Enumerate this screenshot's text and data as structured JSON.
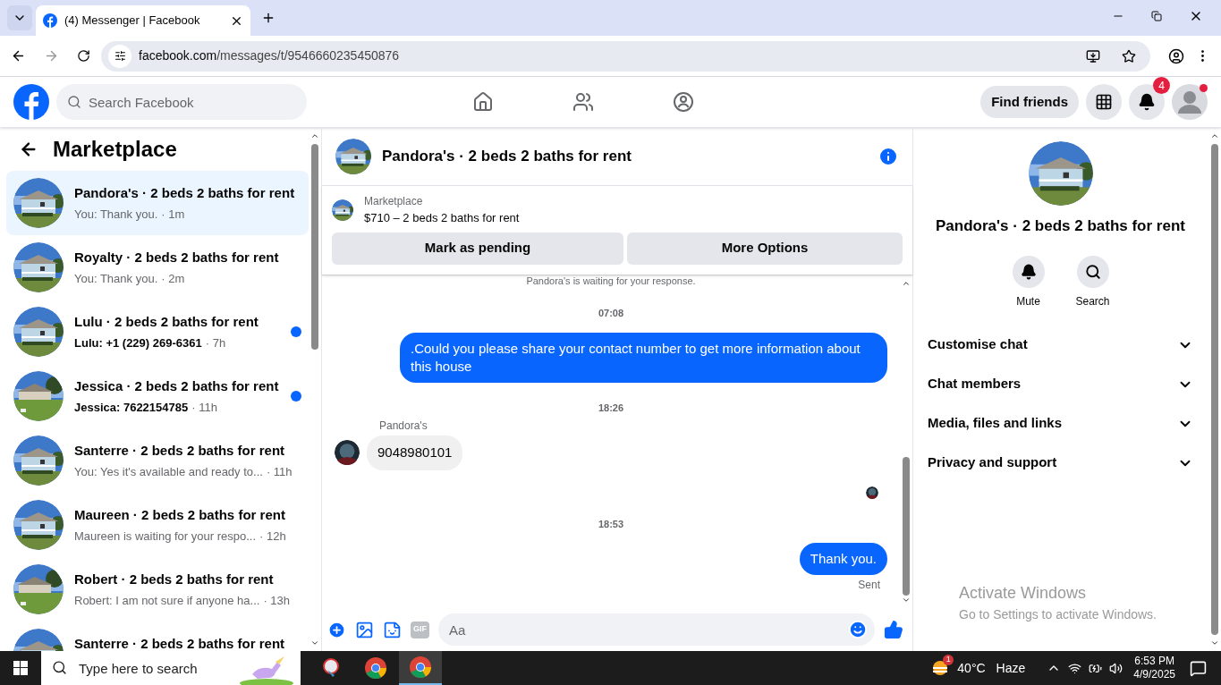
{
  "browser": {
    "tab_title": "(4) Messenger | Facebook",
    "url_host": "facebook.com",
    "url_path": "/messages/t/9546660235450876"
  },
  "header": {
    "search_placeholder": "Search Facebook",
    "find_friends": "Find friends",
    "notification_count": "4"
  },
  "sidebar": {
    "title": "Marketplace",
    "threads": [
      {
        "name": "Pandora's · 2 beds 2 baths for rent",
        "preview": "You: Thank you.",
        "time": "· 1m",
        "unread": false,
        "selected": true
      },
      {
        "name": "Royalty · 2 beds 2 baths for rent",
        "preview": "You: Thank you.",
        "time": "· 2m",
        "unread": false,
        "selected": false
      },
      {
        "name": "Lulu · 2 beds 2 baths for rent",
        "preview": "Lulu: +1 (229) 269-6361",
        "time": "· 7h",
        "unread": true,
        "selected": false
      },
      {
        "name": "Jessica · 2 beds 2 baths for rent",
        "preview": "Jessica: 7622154785",
        "time": "· 11h",
        "unread": true,
        "selected": false
      },
      {
        "name": "Santerre · 2 beds 2 baths for rent",
        "preview": "You: Yes it's available and ready to...",
        "time": "· 11h",
        "unread": false,
        "selected": false
      },
      {
        "name": "Maureen · 2 beds 2 baths for rent",
        "preview": "Maureen is waiting for your respo...",
        "time": "· 12h",
        "unread": false,
        "selected": false
      },
      {
        "name": "Robert · 2 beds 2 baths for rent",
        "preview": "Robert: I am not sure if anyone ha...",
        "time": "· 13h",
        "unread": false,
        "selected": false
      },
      {
        "name": "Santerre · 2 beds 2 baths for rent",
        "unread": false,
        "selected": false
      }
    ]
  },
  "chat": {
    "title": "Pandora's · 2 beds 2 baths for rent",
    "listing": {
      "label": "Marketplace",
      "title": "$710 – 2 beds 2 baths for rent"
    },
    "buttons": [
      "Mark as pending",
      "More Options"
    ],
    "messages": [
      {
        "kind": "notice",
        "text": "Pandora's is waiting for your response."
      },
      {
        "kind": "time",
        "text": "07:08"
      },
      {
        "kind": "outgoing",
        "text": ".Could you please share your contact number to get more information about this house"
      },
      {
        "kind": "time",
        "text": "18:26"
      },
      {
        "kind": "incoming",
        "sender": "Pandora's",
        "text": "9048980101"
      },
      {
        "kind": "seen"
      },
      {
        "kind": "time",
        "text": "18:53"
      },
      {
        "kind": "outgoing",
        "text": "Thank you.",
        "status": "Sent"
      }
    ],
    "gif_label": "GIF",
    "composer_placeholder": "Aa"
  },
  "details": {
    "title": "Pandora's · 2 beds 2 baths for rent",
    "actions": [
      "Mute",
      "Search"
    ],
    "sections": [
      {
        "label": "Customise chat",
        "expanded": false
      },
      {
        "label": "Chat members",
        "expanded": false
      },
      {
        "label": "Media, files and links",
        "expanded": false
      },
      {
        "label": "Privacy and support",
        "expanded": false
      }
    ]
  },
  "activation": {
    "title": "Activate Windows",
    "subtitle": "Go to Settings to activate Windows."
  },
  "taskbar": {
    "search_placeholder": "Type here to search",
    "weather_badge": "1",
    "temperature": "40°C",
    "weather": "Haze",
    "time": "6:53 PM",
    "date": "4/9/2025"
  }
}
